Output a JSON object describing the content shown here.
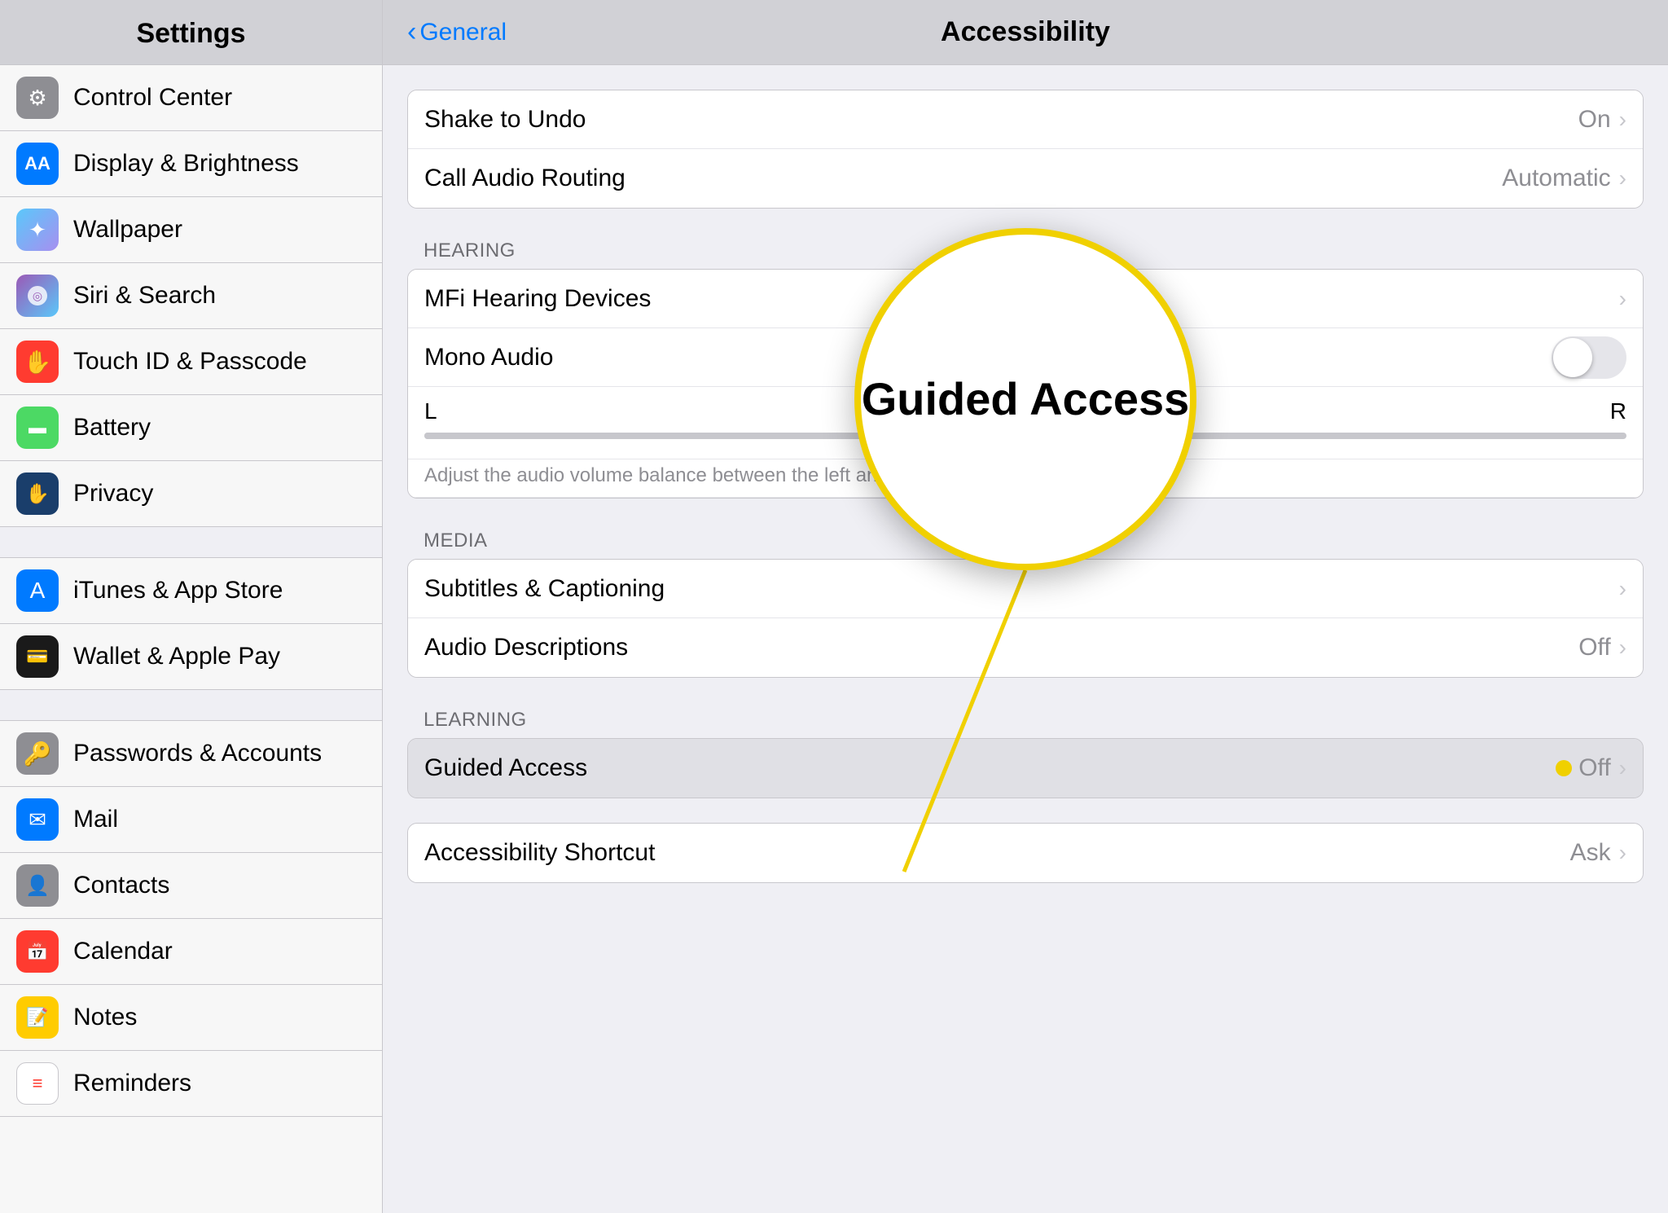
{
  "sidebar": {
    "title": "Settings",
    "items": [
      {
        "id": "control-center",
        "label": "Control Center",
        "icon": "⚙",
        "iconBg": "#8e8e93"
      },
      {
        "id": "display-brightness",
        "label": "Display & Brightness",
        "icon": "AA",
        "iconBg": "#007aff",
        "iconColor": "#fff"
      },
      {
        "id": "wallpaper",
        "label": "Wallpaper",
        "icon": "✦",
        "iconBg": "#5ac8fa"
      },
      {
        "id": "siri-search",
        "label": "Siri & Search",
        "icon": "◎",
        "iconBg": "#9b59b6"
      },
      {
        "id": "touch-id",
        "label": "Touch ID & Passcode",
        "icon": "✋",
        "iconBg": "#ff3b30"
      },
      {
        "id": "battery",
        "label": "Battery",
        "icon": "▬",
        "iconBg": "#4cd964"
      },
      {
        "id": "privacy",
        "label": "Privacy",
        "icon": "✋",
        "iconBg": "#1a3e6b"
      }
    ],
    "divider": true,
    "items2": [
      {
        "id": "itunes",
        "label": "iTunes & App Store",
        "icon": "A",
        "iconBg": "#007aff"
      },
      {
        "id": "wallet",
        "label": "Wallet & Apple Pay",
        "icon": "💳",
        "iconBg": "#1a1a1a"
      }
    ],
    "divider2": true,
    "items3": [
      {
        "id": "passwords",
        "label": "Passwords & Accounts",
        "icon": "🔑",
        "iconBg": "#8e8e93"
      },
      {
        "id": "mail",
        "label": "Mail",
        "icon": "✉",
        "iconBg": "#007aff"
      },
      {
        "id": "contacts",
        "label": "Contacts",
        "icon": "👤",
        "iconBg": "#8e8e93"
      },
      {
        "id": "calendar",
        "label": "Calendar",
        "icon": "📅",
        "iconBg": "#ff3b30"
      },
      {
        "id": "notes",
        "label": "Notes",
        "icon": "📝",
        "iconBg": "#ffcc00"
      },
      {
        "id": "reminders",
        "label": "Reminders",
        "icon": "≡",
        "iconBg": "#fff"
      }
    ]
  },
  "main": {
    "back_label": "General",
    "title": "Accessibility",
    "rows": [
      {
        "label": "Shake to Undo",
        "value": "On",
        "hasChevron": true,
        "type": "value"
      },
      {
        "label": "Call Audio Routing",
        "value": "Automatic",
        "hasChevron": true,
        "type": "value"
      }
    ],
    "hearing_header": "HEARING",
    "hearing_rows": [
      {
        "label": "MFi Hearing Devices",
        "value": "",
        "hasChevron": true,
        "type": "chevron"
      },
      {
        "label": "Mono Audio",
        "value": "",
        "hasChevron": false,
        "type": "toggle",
        "toggleOn": false
      },
      {
        "slider": true,
        "leftLabel": "L",
        "rightLabel": "R"
      },
      {
        "description": "Adjust the audio volume balance between the left and right channels."
      }
    ],
    "media_header": "MEDIA",
    "media_rows": [
      {
        "label": "Subtitles & Captioning",
        "value": "",
        "hasChevron": true,
        "type": "chevron"
      },
      {
        "label": "Audio Descriptions",
        "value": "Off",
        "hasChevron": true,
        "type": "value"
      }
    ],
    "learning_header": "LEARNING",
    "learning_rows": [
      {
        "label": "Guided Access",
        "value": "Off",
        "hasChevron": true,
        "type": "value",
        "highlighted": true
      }
    ],
    "bottom_rows": [
      {
        "label": "Accessibility Shortcut",
        "value": "Ask",
        "hasChevron": true,
        "type": "value"
      }
    ],
    "magnify": {
      "text": "Guided Access",
      "subtext": ""
    }
  }
}
